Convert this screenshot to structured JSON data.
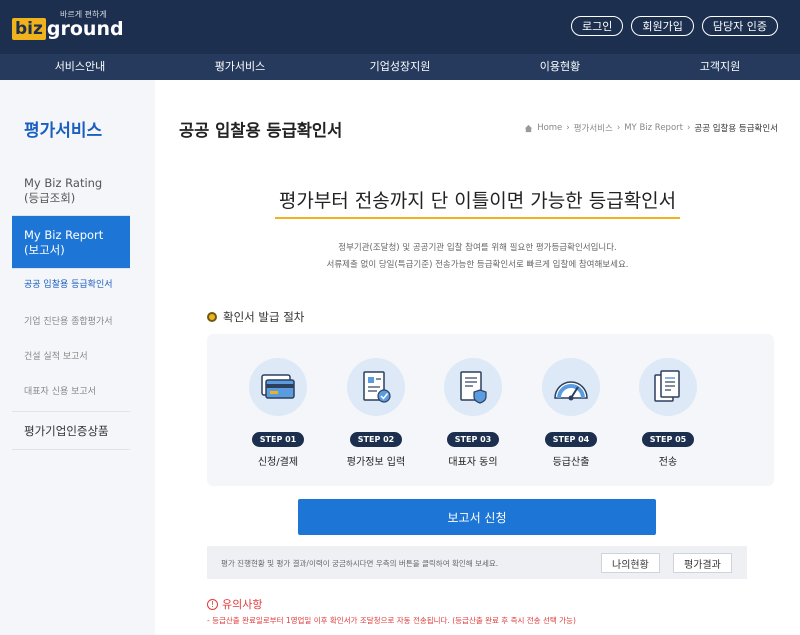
{
  "header": {
    "logo_biz": "biz",
    "logo_ground": "ground",
    "logo_tagline": "바르게 편하게",
    "auth_buttons": [
      "로그인",
      "회원가입",
      "담당자 인증"
    ]
  },
  "gnb": [
    "서비스안내",
    "평가서비스",
    "기업성장지원",
    "이용현황",
    "고객지원"
  ],
  "sidebar": {
    "title": "평가서비스",
    "items": [
      {
        "label": "My Biz Rating\n(등급조회)"
      },
      {
        "label": "My Biz Report\n(보고서)"
      },
      {
        "label": "평가기업인증상품"
      }
    ],
    "sub_items": [
      "공공 입찰용 등급확인서",
      "기업 진단용 종합평가서",
      "건설 실적 보고서",
      "대표자 신용 보고서"
    ]
  },
  "page": {
    "title": "공공 입찰용 등급확인서",
    "breadcrumb": [
      "Home",
      "평가서비스",
      "MY Biz Report",
      "공공 입찰용 등급확인서"
    ],
    "hero_title": "평가부터 전송까지 단 이틀이면 가능한 등급확인서",
    "hero_desc_1": "정부기관(조달청) 및 공공기관 입찰 참여를 위해 필요한 평가등급확인서입니다.",
    "hero_desc_2": "서류제출 없이 당일(특급기준) 전송가능한 등급확인서로 빠르게 입찰에 참여해보세요.",
    "process_title": "확인서 발급 절차",
    "steps": [
      {
        "badge": "STEP 01",
        "label": "신청/결제",
        "icon": "card-icon"
      },
      {
        "badge": "STEP 02",
        "label": "평가정보 입력",
        "icon": "document-check-icon"
      },
      {
        "badge": "STEP 03",
        "label": "대표자 동의",
        "icon": "document-shield-icon"
      },
      {
        "badge": "STEP 04",
        "label": "등급산출",
        "icon": "gauge-icon"
      },
      {
        "badge": "STEP 05",
        "label": "전송",
        "icon": "documents-send-icon"
      }
    ],
    "apply_button": "보고서 신청",
    "status_text": "평가 진행현황 및 평가 결과/이력이 궁금하시다면 우측의 버튼을 클릭하여 확인해 보세요.",
    "status_buttons": [
      "나의현황",
      "평가결과"
    ],
    "notice_title": "유의사항",
    "notice_text": "- 등급산출 완료일로부터 1영업일 이후 확인서가 조달청으로 자동 전송됩니다. (등급산출 완료 후 즉시 전송 선택 가능)"
  }
}
